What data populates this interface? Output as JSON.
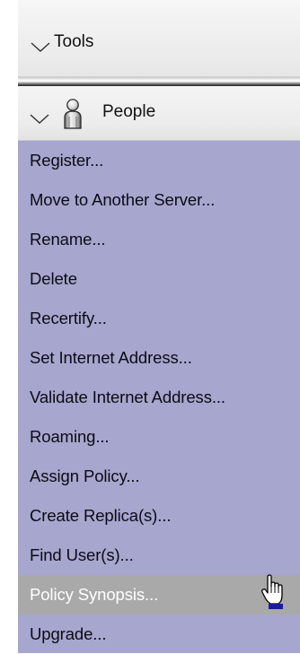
{
  "tools": {
    "label": "Tools"
  },
  "people": {
    "label": "People",
    "icon": "person-icon"
  },
  "menu": {
    "items": [
      {
        "label": "Register..."
      },
      {
        "label": "Move to Another Server..."
      },
      {
        "label": "Rename..."
      },
      {
        "label": "Delete"
      },
      {
        "label": "Recertify..."
      },
      {
        "label": "Set Internet Address..."
      },
      {
        "label": "Validate Internet Address..."
      },
      {
        "label": "Roaming..."
      },
      {
        "label": "Assign Policy..."
      },
      {
        "label": "Create Replica(s)..."
      },
      {
        "label": "Find User(s)..."
      },
      {
        "label": "Policy Synopsis...",
        "selected": true
      },
      {
        "label": "Upgrade..."
      }
    ]
  },
  "colors": {
    "menu_background": "#a6a6cf",
    "selected_background": "#a9a9a9",
    "selected_text": "#ffffff"
  },
  "cursor": {
    "icon": "hand-pointer-icon"
  }
}
